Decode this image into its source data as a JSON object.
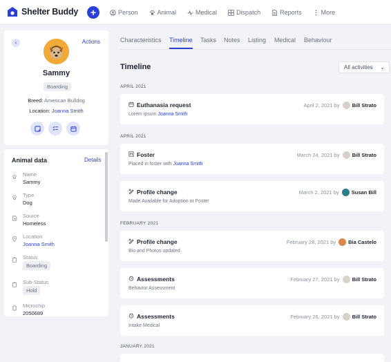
{
  "app": {
    "name": "Shelter Buddy"
  },
  "nav": {
    "add_label": "+",
    "items": [
      {
        "label": "Person",
        "icon": "person-icon"
      },
      {
        "label": "Animal",
        "icon": "paw-icon"
      },
      {
        "label": "Medical",
        "icon": "pulse-icon"
      },
      {
        "label": "Dispatch",
        "icon": "grid-icon"
      },
      {
        "label": "Reports",
        "icon": "document-icon"
      },
      {
        "label": "More",
        "icon": "more-vertical-icon"
      }
    ]
  },
  "profile": {
    "back": "‹",
    "actions_label": "Actions",
    "name": "Sammy",
    "status": "Boarding",
    "breed_label": "Breed:",
    "breed": "American Bulldog",
    "location_label": "Location:",
    "location": "Joanna Smith",
    "quick_actions": [
      "note-icon",
      "checklist-icon",
      "calendar-icon"
    ]
  },
  "animal_data": {
    "title": "Animal data",
    "details_label": "Details",
    "fields": [
      {
        "label": "Name",
        "value": "Sammy",
        "icon": "paw-icon",
        "kind": "text"
      },
      {
        "label": "Type",
        "value": "Dog",
        "icon": "paw-icon",
        "kind": "text"
      },
      {
        "label": "Source",
        "value": "Homeless",
        "icon": "import-icon",
        "kind": "text"
      },
      {
        "label": "Location",
        "value": "Joanna Smith",
        "icon": "location-pin-icon",
        "kind": "link"
      },
      {
        "label": "Status",
        "value": "Boarding",
        "icon": "clipboard-icon",
        "kind": "badge"
      },
      {
        "label": "Sub-Status",
        "value": "Hold",
        "icon": "clipboard-icon",
        "kind": "badge"
      },
      {
        "label": "Microchip",
        "value": "2050689",
        "icon": "chip-icon",
        "kind": "text"
      }
    ]
  },
  "tabs": [
    {
      "label": "Characteristics",
      "active": false
    },
    {
      "label": "Timeline",
      "active": true
    },
    {
      "label": "Tasks",
      "active": false
    },
    {
      "label": "Notes",
      "active": false
    },
    {
      "label": "Listing",
      "active": false
    },
    {
      "label": "Medical",
      "active": false
    },
    {
      "label": "Behaviour",
      "active": false
    }
  ],
  "timeline": {
    "title": "Timeline",
    "filter": "All activities",
    "months": [
      "APRIL 2021",
      "APRIL 2021",
      "FEBRUARY 2021",
      "JANUARY 2021"
    ],
    "events": [
      {
        "icon": "calendar-icon",
        "title": "Euthanasia request",
        "desc": "Lorem ipsum",
        "desc_link": "Joanna Smith",
        "date": "April 2, 2021",
        "by": "by",
        "user": "Bill Strato"
      },
      {
        "icon": "foster-icon",
        "title": "Foster",
        "desc": "Placed in foster with",
        "desc_link": "Joanna Smith",
        "date": "March 24, 2021",
        "by": "by",
        "user": "Bill Strato"
      },
      {
        "icon": "edit-profile-icon",
        "title": "Profile change",
        "desc": "Made Available for Adoption or Foster",
        "desc_link": "",
        "date": "March 2, 2021",
        "by": "by",
        "user": "Susan Bill"
      },
      {
        "icon": "edit-profile-icon",
        "title": "Profile change",
        "desc": "Bio and Photos updated",
        "desc_link": "",
        "date": "February 28, 2021",
        "by": "by",
        "user": "Bia Castelo"
      },
      {
        "icon": "assessment-icon",
        "title": "Assessments",
        "desc": "Behavior Assessment",
        "desc_link": "",
        "date": "February 27, 2021",
        "by": "by",
        "user": "Bill Strato"
      },
      {
        "icon": "assessment-icon",
        "title": "Assessments",
        "desc": "Intake Medical",
        "desc_link": "",
        "date": "February 26, 2021",
        "by": "by",
        "user": "Bill Strato"
      }
    ]
  },
  "colors": {
    "accent": "#2a3fd6",
    "background": "#f2f3f6",
    "card": "#ffffff"
  }
}
